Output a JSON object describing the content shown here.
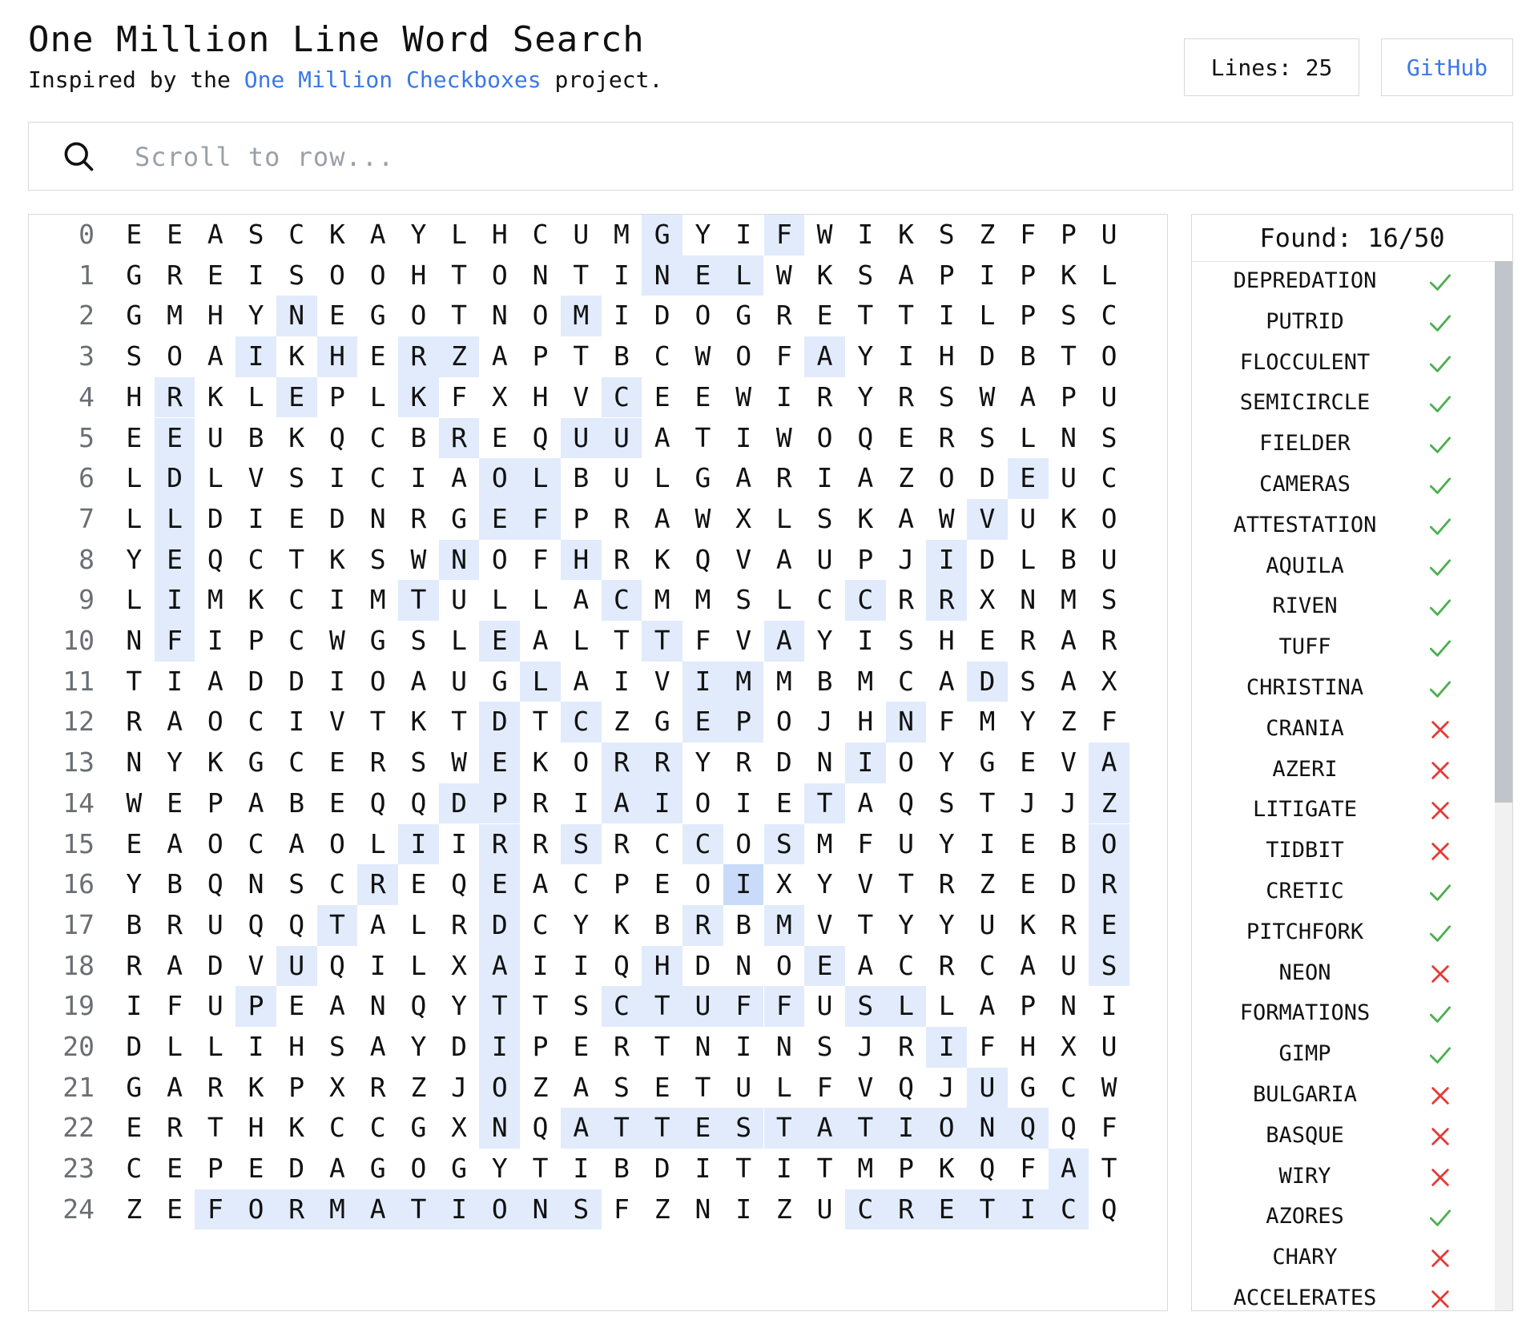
{
  "header": {
    "title": "One Million Line Word Search",
    "subtitle_prefix": "Inspired by the ",
    "subtitle_link": "One Million Checkboxes",
    "subtitle_suffix": " project.",
    "lines_label": "Lines: 25",
    "github_label": "GitHub"
  },
  "search": {
    "placeholder": "Scroll to row...",
    "value": ""
  },
  "colors": {
    "link": "#3b78e7",
    "found_highlight": "#e1ebfb",
    "selected_highlight": "#c9dbf8",
    "check": "#4caf50",
    "cross": "#e53935"
  },
  "grid": {
    "rows": [
      "EEASCKAYLHCUMGYIFWIKSZFPU",
      "GREISOOHTONTINELWKSAPIPKL",
      "GMHYNEGOTNOMIDOGRETTILPSC",
      "SOAIKHERZAPTBCWOFAYIHDBTO",
      "HRKLEPLKFXHVCEEWIRYRSWAPU",
      "EEUBKQCBREQUUATIWOQERSLNS",
      "LDLVSICIAOLBULGARIAZODEUC",
      "LLDIEDNRGEFPRAWXLSKAWVUKO",
      "YEQCTKSWNOFHRKQVAUPJIDLBU",
      "LIMKCIMTULLACMMSLCCRRXNMS",
      "NFIPCWGSLEALTTFVAYISHERAR",
      "TIADDIOAUGLAIVIMMBMCADSAX",
      "RAOCIVTKTDTCZGEPOJHNFMYZF",
      "NYKGCERSWEKORRYRDNIOYGEVA",
      "WEPABEQQDPRIAIOIETAQSTJJZ",
      "EAOCAOLIIRRSRCCOSMFUYIEBO",
      "YBQNSCREQEACPEOIXYVTRZEDR",
      "BRUQQTALRDCYKBRBMVTYYUKRE",
      "RADVUQILXAIIQHDNOEACRCAUS",
      "IFUPEANQYTTSCTUFFUSLLAPNI",
      "DLLIHSAYDIPERTNINSJRIFHXU",
      "GARKPXRZJOZASETULFVQJUGCW",
      "ERTHKCCGXNQATTESTATIONQQF",
      "CEPEDAGOGYTIBDITITMPKQFAT",
      "ZEFORMATIONSFZNIZUCRETICQ"
    ],
    "highlights": [
      [
        13,
        16
      ],
      [
        13,
        14,
        15
      ],
      [
        4,
        11
      ],
      [
        3,
        5,
        7,
        8,
        17
      ],
      [
        1,
        4,
        7,
        12
      ],
      [
        1,
        8,
        11,
        12
      ],
      [
        1,
        9,
        10,
        22
      ],
      [
        1,
        9,
        10,
        21
      ],
      [
        1,
        8,
        11,
        20
      ],
      [
        1,
        7,
        12,
        18,
        20
      ],
      [
        1,
        9,
        13,
        16
      ],
      [
        10,
        14,
        15,
        21
      ],
      [
        9,
        11,
        14,
        15,
        19
      ],
      [
        9,
        12,
        13,
        18,
        24
      ],
      [
        8,
        9,
        12,
        13,
        17,
        24
      ],
      [
        7,
        9,
        11,
        14,
        16,
        24
      ],
      [
        6,
        9,
        15,
        24
      ],
      [
        5,
        9,
        14,
        16,
        24
      ],
      [
        4,
        9,
        13,
        17,
        24
      ],
      [
        3,
        9,
        12,
        13,
        14,
        15,
        16,
        18,
        19
      ],
      [
        9,
        20
      ],
      [
        9,
        21
      ],
      [
        9,
        11,
        12,
        13,
        14,
        15,
        16,
        17,
        18,
        19,
        20,
        21,
        22
      ],
      [
        23
      ],
      [
        2,
        3,
        4,
        5,
        6,
        7,
        8,
        9,
        10,
        11,
        18,
        19,
        20,
        21,
        22,
        23
      ]
    ],
    "selected_cell": [
      16,
      15
    ]
  },
  "found": {
    "header": "Found: 16/50",
    "words": [
      {
        "word": "DEPREDATION",
        "found": true
      },
      {
        "word": "PUTRID",
        "found": true
      },
      {
        "word": "FLOCCULENT",
        "found": true
      },
      {
        "word": "SEMICIRCLE",
        "found": true
      },
      {
        "word": "FIELDER",
        "found": true
      },
      {
        "word": "CAMERAS",
        "found": true
      },
      {
        "word": "ATTESTATION",
        "found": true
      },
      {
        "word": "AQUILA",
        "found": true
      },
      {
        "word": "RIVEN",
        "found": true
      },
      {
        "word": "TUFF",
        "found": true
      },
      {
        "word": "CHRISTINA",
        "found": true
      },
      {
        "word": "CRANIA",
        "found": false
      },
      {
        "word": "AZERI",
        "found": false
      },
      {
        "word": "LITIGATE",
        "found": false
      },
      {
        "word": "TIDBIT",
        "found": false
      },
      {
        "word": "CRETIC",
        "found": true
      },
      {
        "word": "PITCHFORK",
        "found": true
      },
      {
        "word": "NEON",
        "found": false
      },
      {
        "word": "FORMATIONS",
        "found": true
      },
      {
        "word": "GIMP",
        "found": true
      },
      {
        "word": "BULGARIA",
        "found": false
      },
      {
        "word": "BASQUE",
        "found": false
      },
      {
        "word": "WIRY",
        "found": false
      },
      {
        "word": "AZORES",
        "found": true
      },
      {
        "word": "CHARY",
        "found": false
      },
      {
        "word": "ACCELERATES",
        "found": false
      }
    ]
  }
}
